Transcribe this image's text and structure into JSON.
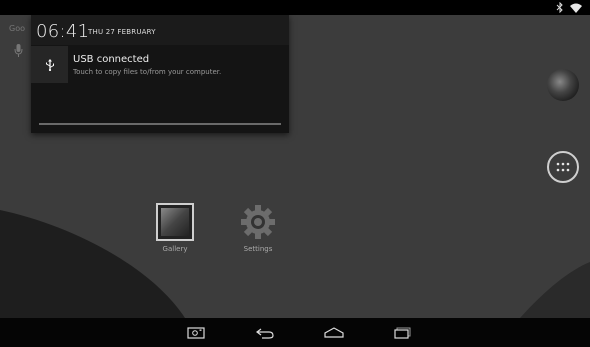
{
  "notification_shade": {
    "time": "06:41",
    "date": "THU 27 FEBRUARY",
    "notification": {
      "title": "USB connected",
      "text": "Touch to copy files to/from your computer."
    }
  },
  "behind_shade": {
    "search_label": "Goo"
  },
  "desktop": {
    "apps": [
      {
        "label": "Gallery",
        "icon": "gallery-icon"
      },
      {
        "label": "Settings",
        "icon": "gear-icon"
      }
    ]
  },
  "icons": {
    "status": [
      "bluetooth-icon",
      "wifi-icon"
    ],
    "nav": [
      "camera-icon",
      "back-icon",
      "home-icon",
      "recents-icon"
    ],
    "right_dock": [
      "browser-icon",
      "all-apps-icon"
    ],
    "left_dock": [
      "mic-icon"
    ],
    "notification": "usb-icon"
  },
  "colors": {
    "status_bar": "#000000",
    "nav_bar": "#050505",
    "shade": "#141414",
    "wallpaper": "#3a3a3a"
  }
}
